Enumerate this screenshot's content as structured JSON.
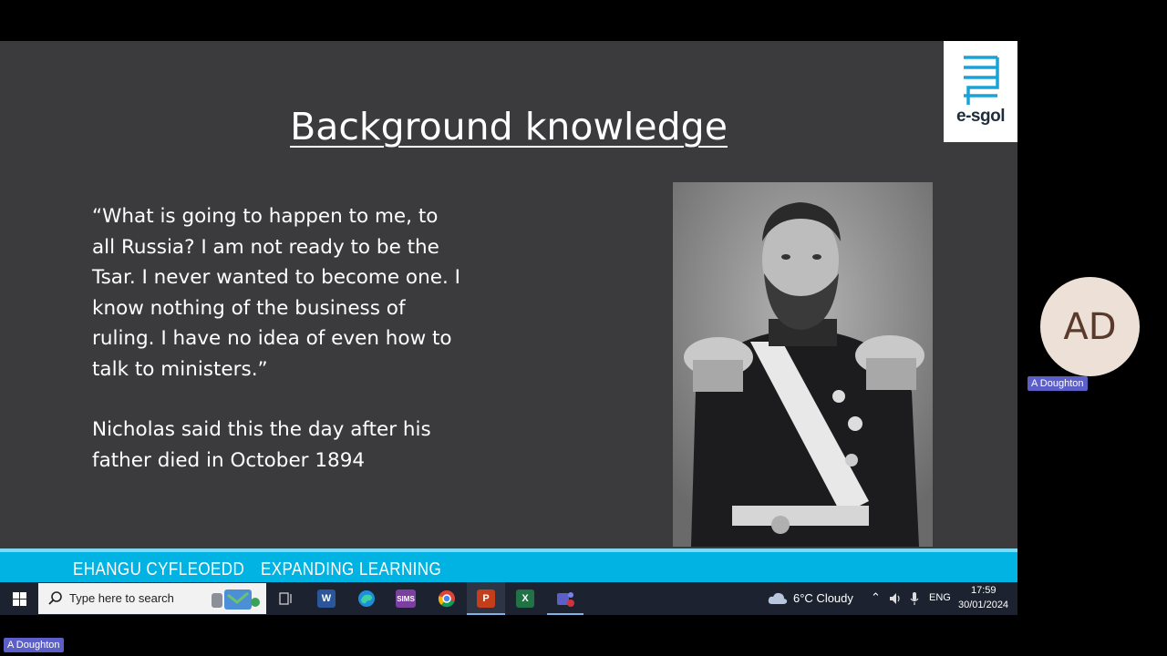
{
  "slide": {
    "title": "Background knowledge",
    "quote": "“What is going to happen to me, to all Russia? I am not ready to be the Tsar. I never wanted to become one. I know nothing of the business of ruling. I have no idea of even how to talk to ministers.”",
    "attribution": "Nicholas said this the day after his father died in October 1894",
    "logo_text": "e-sgol",
    "banner_welsh": "EHANGU CYFLEOEDD",
    "banner_english": "EXPANDING LEARNING"
  },
  "participant": {
    "initials": "AD",
    "name": "A Doughton",
    "self_name": "A Doughton"
  },
  "taskbar": {
    "search_placeholder": "Type here to search",
    "apps": [
      {
        "name": "task-view-icon",
        "label": ""
      },
      {
        "name": "word-icon",
        "label": "W"
      },
      {
        "name": "edge-icon",
        "label": ""
      },
      {
        "name": "sims-icon",
        "label": "SIMS"
      },
      {
        "name": "chrome-icon",
        "label": ""
      },
      {
        "name": "powerpoint-icon",
        "label": "P"
      },
      {
        "name": "excel-icon",
        "label": "X"
      },
      {
        "name": "teams-icon",
        "label": ""
      }
    ],
    "weather": "6°C  Cloudy",
    "language": "ENG",
    "time": "17:59",
    "date": "30/01/2024"
  },
  "colors": {
    "slide_bg": "#3b3b3d",
    "banner": "#00b3e3",
    "taskbar": "#1c2230",
    "teams_purple": "#5b5fc7"
  }
}
